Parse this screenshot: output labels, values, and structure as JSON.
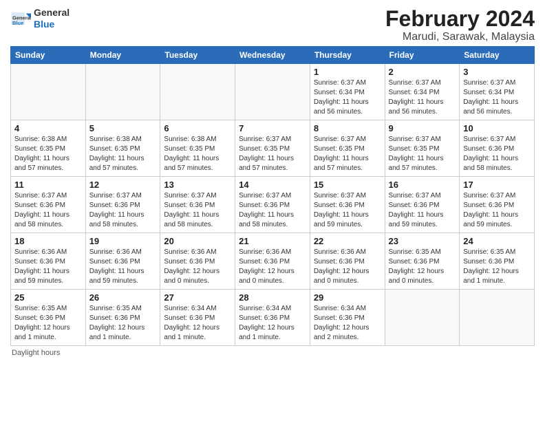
{
  "header": {
    "logo_general": "General",
    "logo_blue": "Blue",
    "main_title": "February 2024",
    "subtitle": "Marudi, Sarawak, Malaysia"
  },
  "calendar": {
    "weekdays": [
      "Sunday",
      "Monday",
      "Tuesday",
      "Wednesday",
      "Thursday",
      "Friday",
      "Saturday"
    ],
    "weeks": [
      [
        {
          "day": "",
          "info": ""
        },
        {
          "day": "",
          "info": ""
        },
        {
          "day": "",
          "info": ""
        },
        {
          "day": "",
          "info": ""
        },
        {
          "day": "1",
          "info": "Sunrise: 6:37 AM\nSunset: 6:34 PM\nDaylight: 11 hours and 56 minutes."
        },
        {
          "day": "2",
          "info": "Sunrise: 6:37 AM\nSunset: 6:34 PM\nDaylight: 11 hours and 56 minutes."
        },
        {
          "day": "3",
          "info": "Sunrise: 6:37 AM\nSunset: 6:34 PM\nDaylight: 11 hours and 56 minutes."
        }
      ],
      [
        {
          "day": "4",
          "info": "Sunrise: 6:38 AM\nSunset: 6:35 PM\nDaylight: 11 hours and 57 minutes."
        },
        {
          "day": "5",
          "info": "Sunrise: 6:38 AM\nSunset: 6:35 PM\nDaylight: 11 hours and 57 minutes."
        },
        {
          "day": "6",
          "info": "Sunrise: 6:38 AM\nSunset: 6:35 PM\nDaylight: 11 hours and 57 minutes."
        },
        {
          "day": "7",
          "info": "Sunrise: 6:37 AM\nSunset: 6:35 PM\nDaylight: 11 hours and 57 minutes."
        },
        {
          "day": "8",
          "info": "Sunrise: 6:37 AM\nSunset: 6:35 PM\nDaylight: 11 hours and 57 minutes."
        },
        {
          "day": "9",
          "info": "Sunrise: 6:37 AM\nSunset: 6:35 PM\nDaylight: 11 hours and 57 minutes."
        },
        {
          "day": "10",
          "info": "Sunrise: 6:37 AM\nSunset: 6:36 PM\nDaylight: 11 hours and 58 minutes."
        }
      ],
      [
        {
          "day": "11",
          "info": "Sunrise: 6:37 AM\nSunset: 6:36 PM\nDaylight: 11 hours and 58 minutes."
        },
        {
          "day": "12",
          "info": "Sunrise: 6:37 AM\nSunset: 6:36 PM\nDaylight: 11 hours and 58 minutes."
        },
        {
          "day": "13",
          "info": "Sunrise: 6:37 AM\nSunset: 6:36 PM\nDaylight: 11 hours and 58 minutes."
        },
        {
          "day": "14",
          "info": "Sunrise: 6:37 AM\nSunset: 6:36 PM\nDaylight: 11 hours and 58 minutes."
        },
        {
          "day": "15",
          "info": "Sunrise: 6:37 AM\nSunset: 6:36 PM\nDaylight: 11 hours and 59 minutes."
        },
        {
          "day": "16",
          "info": "Sunrise: 6:37 AM\nSunset: 6:36 PM\nDaylight: 11 hours and 59 minutes."
        },
        {
          "day": "17",
          "info": "Sunrise: 6:37 AM\nSunset: 6:36 PM\nDaylight: 11 hours and 59 minutes."
        }
      ],
      [
        {
          "day": "18",
          "info": "Sunrise: 6:36 AM\nSunset: 6:36 PM\nDaylight: 11 hours and 59 minutes."
        },
        {
          "day": "19",
          "info": "Sunrise: 6:36 AM\nSunset: 6:36 PM\nDaylight: 11 hours and 59 minutes."
        },
        {
          "day": "20",
          "info": "Sunrise: 6:36 AM\nSunset: 6:36 PM\nDaylight: 12 hours and 0 minutes."
        },
        {
          "day": "21",
          "info": "Sunrise: 6:36 AM\nSunset: 6:36 PM\nDaylight: 12 hours and 0 minutes."
        },
        {
          "day": "22",
          "info": "Sunrise: 6:36 AM\nSunset: 6:36 PM\nDaylight: 12 hours and 0 minutes."
        },
        {
          "day": "23",
          "info": "Sunrise: 6:35 AM\nSunset: 6:36 PM\nDaylight: 12 hours and 0 minutes."
        },
        {
          "day": "24",
          "info": "Sunrise: 6:35 AM\nSunset: 6:36 PM\nDaylight: 12 hours and 1 minute."
        }
      ],
      [
        {
          "day": "25",
          "info": "Sunrise: 6:35 AM\nSunset: 6:36 PM\nDaylight: 12 hours and 1 minute."
        },
        {
          "day": "26",
          "info": "Sunrise: 6:35 AM\nSunset: 6:36 PM\nDaylight: 12 hours and 1 minute."
        },
        {
          "day": "27",
          "info": "Sunrise: 6:34 AM\nSunset: 6:36 PM\nDaylight: 12 hours and 1 minute."
        },
        {
          "day": "28",
          "info": "Sunrise: 6:34 AM\nSunset: 6:36 PM\nDaylight: 12 hours and 1 minute."
        },
        {
          "day": "29",
          "info": "Sunrise: 6:34 AM\nSunset: 6:36 PM\nDaylight: 12 hours and 2 minutes."
        },
        {
          "day": "",
          "info": ""
        },
        {
          "day": "",
          "info": ""
        }
      ]
    ]
  },
  "footer": {
    "note": "Daylight hours"
  }
}
